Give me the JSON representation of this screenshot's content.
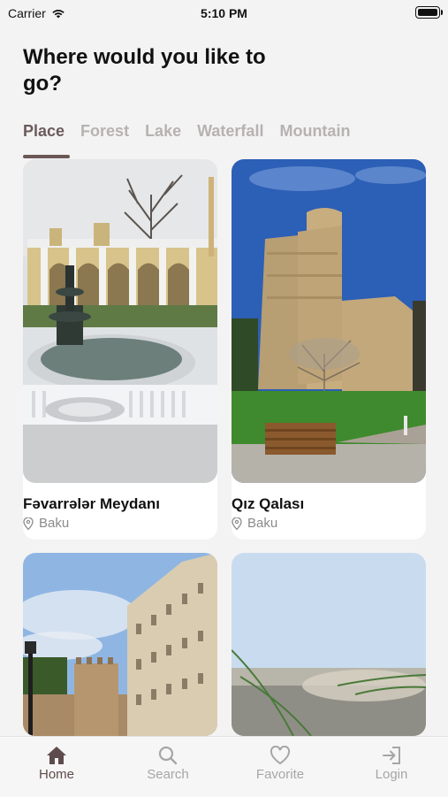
{
  "status": {
    "carrier": "Carrier",
    "time": "5:10 PM"
  },
  "header": {
    "title": "Where would you like to go?"
  },
  "tabs": [
    {
      "label": "Place",
      "active": true
    },
    {
      "label": "Forest",
      "active": false
    },
    {
      "label": "Lake",
      "active": false
    },
    {
      "label": "Waterfall",
      "active": false
    },
    {
      "label": "Mountain",
      "active": false
    }
  ],
  "cards": [
    {
      "name": "Fəvarrələr Meydanı",
      "location": "Baku"
    },
    {
      "name": "Qız Qalası",
      "location": "Baku"
    },
    {
      "name": "",
      "location": ""
    },
    {
      "name": "",
      "location": ""
    }
  ],
  "tabbar": [
    {
      "label": "Home",
      "icon": "home-icon"
    },
    {
      "label": "Search",
      "icon": "search-icon"
    },
    {
      "label": "Favorite",
      "icon": "heart-icon"
    },
    {
      "label": "Login",
      "icon": "login-icon"
    }
  ],
  "colors": {
    "accent": "#6b5656",
    "inactive": "#b7b2b2",
    "background": "#f4f3f3"
  }
}
